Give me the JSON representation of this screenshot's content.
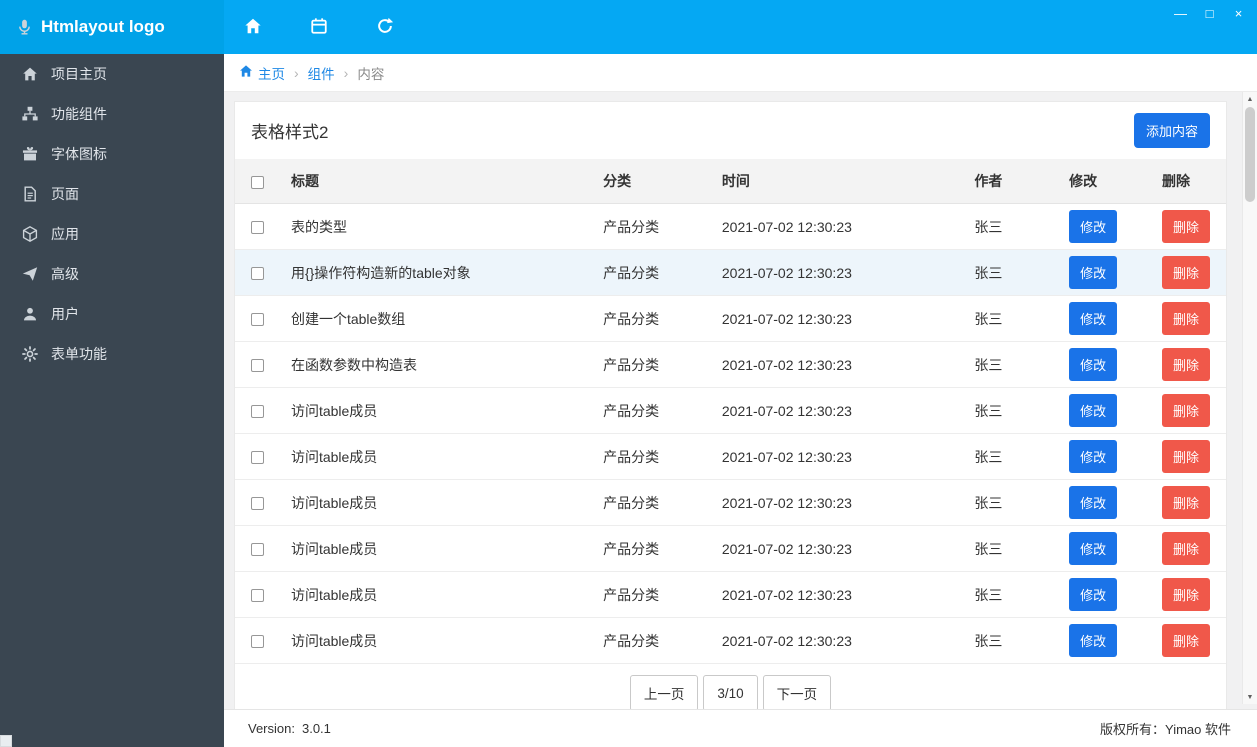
{
  "window": {
    "title": "Htmlayout logo",
    "controls": {
      "minimize": "—",
      "maximize": "□",
      "close": "×"
    }
  },
  "sidebar": {
    "items": [
      {
        "label": "项目主页"
      },
      {
        "label": "功能组件"
      },
      {
        "label": "字体图标"
      },
      {
        "label": "页面"
      },
      {
        "label": "应用"
      },
      {
        "label": "高级"
      },
      {
        "label": "用户"
      },
      {
        "label": "表单功能"
      }
    ]
  },
  "breadcrumb": {
    "home": "主页",
    "separator": "›",
    "section": "组件",
    "current": "内容"
  },
  "content": {
    "card_title": "表格样式2",
    "add_button": "添加内容",
    "table": {
      "headers": {
        "title": "标题",
        "category": "分类",
        "time": "时间",
        "author": "作者",
        "edit": "修改",
        "delete": "删除"
      },
      "edit_label": "修改",
      "delete_label": "删除",
      "rows": [
        {
          "title": "表的类型",
          "category": "产品分类",
          "time": "2021-07-02 12:30:23",
          "author": "张三"
        },
        {
          "title": "用{}操作符构造新的table对象",
          "category": "产品分类",
          "time": "2021-07-02 12:30:23",
          "author": "张三"
        },
        {
          "title": "创建一个table数组",
          "category": "产品分类",
          "time": "2021-07-02 12:30:23",
          "author": "张三"
        },
        {
          "title": "在函数参数中构造表",
          "category": "产品分类",
          "time": "2021-07-02 12:30:23",
          "author": "张三"
        },
        {
          "title": "访问table成员",
          "category": "产品分类",
          "time": "2021-07-02 12:30:23",
          "author": "张三"
        },
        {
          "title": "访问table成员",
          "category": "产品分类",
          "time": "2021-07-02 12:30:23",
          "author": "张三"
        },
        {
          "title": "访问table成员",
          "category": "产品分类",
          "time": "2021-07-02 12:30:23",
          "author": "张三"
        },
        {
          "title": "访问table成员",
          "category": "产品分类",
          "time": "2021-07-02 12:30:23",
          "author": "张三"
        },
        {
          "title": "访问table成员",
          "category": "产品分类",
          "time": "2021-07-02 12:30:23",
          "author": "张三"
        },
        {
          "title": "访问table成员",
          "category": "产品分类",
          "time": "2021-07-02 12:30:23",
          "author": "张三"
        }
      ]
    },
    "pagination": {
      "prev": "上一页",
      "current": "3/10",
      "next": "下一页"
    }
  },
  "scrollbar": {
    "up": "▲",
    "down": "▼"
  },
  "footer": {
    "version_label": "Version:",
    "version_value": "3.0.1",
    "copyright": "版权所有：Yimao 软件"
  },
  "colors": {
    "topbar": "#05a8f3",
    "logo_bg": "#00a2e8",
    "sidebar_bg": "#3a4651",
    "link": "#1e88e5",
    "edit_button": "#1a73e8",
    "delete_button": "#f0584a",
    "header_row_bg": "#f3f3f3",
    "row_highlight": "#edf5fb"
  }
}
